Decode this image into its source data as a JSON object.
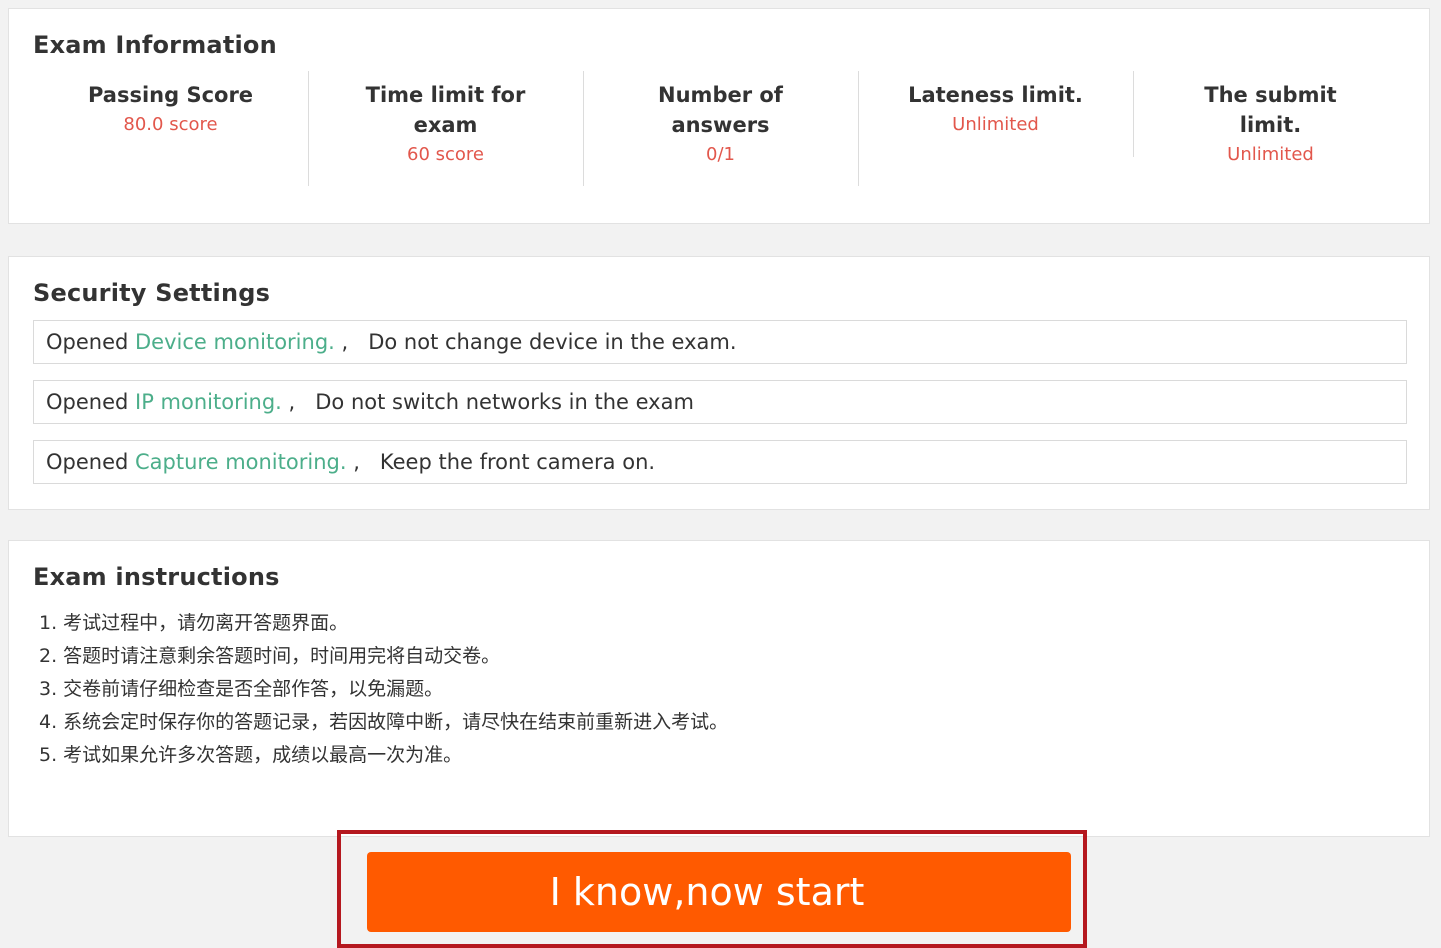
{
  "exam_information": {
    "title": "Exam Information",
    "stats": [
      {
        "label": "Passing Score",
        "value": "80.0 score"
      },
      {
        "label": "Time limit for exam",
        "value": "60 score"
      },
      {
        "label": "Number of answers",
        "value": "0/1"
      },
      {
        "label": "Lateness limit.",
        "value": "Unlimited"
      },
      {
        "label": "The submit limit.",
        "value": "Unlimited"
      }
    ]
  },
  "security_settings": {
    "title": "Security Settings",
    "rows": [
      {
        "prefix": "Opened ",
        "link": "Device monitoring.",
        "separator": " ,",
        "text": "Do not change device in the exam."
      },
      {
        "prefix": "Opened ",
        "link": "IP monitoring.",
        "separator": " ,",
        "text": "Do not switch networks in the exam"
      },
      {
        "prefix": "Opened ",
        "link": "Capture monitoring.",
        "separator": " ,",
        "text": "Keep the front camera on."
      }
    ]
  },
  "exam_instructions": {
    "title": "Exam instructions",
    "items": [
      "1. 考试过程中，请勿离开答题界面。",
      "2. 答题时请注意剩余答题时间，时间用完将自动交卷。",
      "3. 交卷前请仔细检查是否全部作答，以免漏题。",
      "4. 系统会定时保存你的答题记录，若因故障中断，请尽快在结束前重新进入考试。",
      "5. 考试如果允许多次答题，成绩以最高一次为准。"
    ]
  },
  "start_button": {
    "label": "I know,now start"
  },
  "colors": {
    "background": "#f2f2f2",
    "value_red": "#e2574c",
    "link_green": "#4cae8a",
    "button_orange": "#ff5a00",
    "highlight_frame": "#b5181f"
  }
}
